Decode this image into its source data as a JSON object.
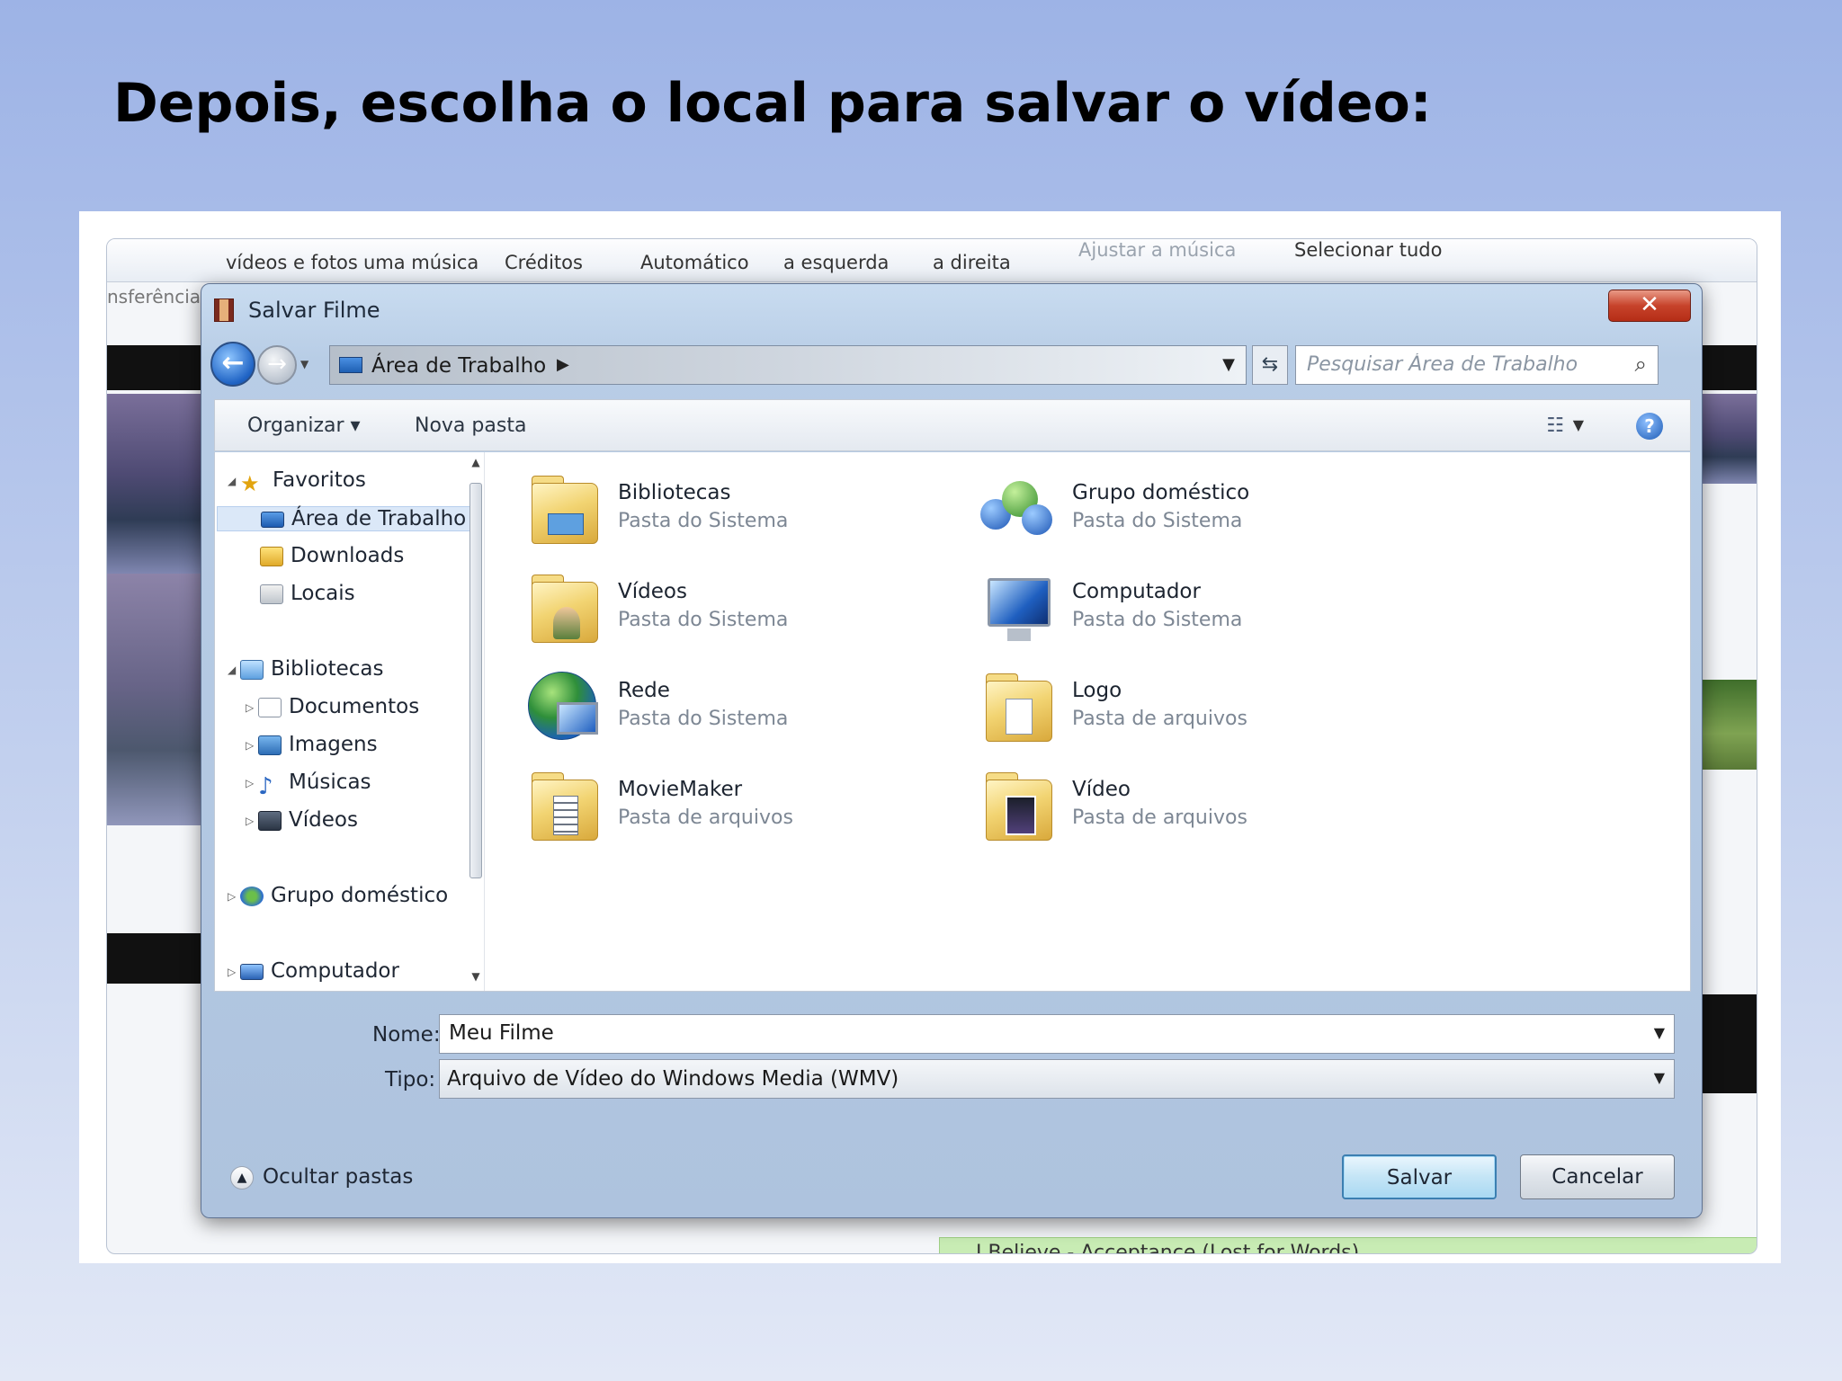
{
  "slide": {
    "title": "Depois, escolha o local para salvar o vídeo:"
  },
  "background_app": {
    "ribbon": {
      "add_videos": "vídeos e fotos",
      "add_music": "uma música",
      "credits": "Créditos",
      "auto_movie": "Automático",
      "rotate_left": "a esquerda",
      "rotate_right": "a direita",
      "fit_music": "Ajustar a música",
      "select_all": "Selecionar tudo"
    },
    "left_label": "nsferência",
    "song_caption": "I Believe - Acceptance (Lost for Words)"
  },
  "dialog": {
    "title": "Salvar Filme",
    "close_label": "✕",
    "address": {
      "path": "Área de Trabalho"
    },
    "search": {
      "placeholder": "Pesquisar Área de Trabalho"
    },
    "toolbar": {
      "organize": "Organizar ▾",
      "new_folder": "Nova pasta",
      "help": "?"
    },
    "nav_pane": {
      "favorites": "Favoritos",
      "desktop": "Área de Trabalho",
      "downloads": "Downloads",
      "places": "Locais",
      "libraries": "Bibliotecas",
      "documents": "Documentos",
      "images": "Imagens",
      "music": "Músicas",
      "videos": "Vídeos",
      "homegroup": "Grupo doméstico",
      "computer": "Computador"
    },
    "items": [
      {
        "name": "Bibliotecas",
        "type": "Pasta do Sistema",
        "icon": "libraries-icon"
      },
      {
        "name": "Grupo doméstico",
        "type": "Pasta do Sistema",
        "icon": "homegroup-icon"
      },
      {
        "name": "Vídeos",
        "type": "Pasta do Sistema",
        "icon": "videos-folder-icon"
      },
      {
        "name": "Computador",
        "type": "Pasta do Sistema",
        "icon": "computer-icon"
      },
      {
        "name": "Rede",
        "type": "Pasta do Sistema",
        "icon": "network-icon"
      },
      {
        "name": "Logo",
        "type": "Pasta de arquivos",
        "icon": "folder-icon"
      },
      {
        "name": "MovieMaker",
        "type": "Pasta de arquivos",
        "icon": "folder-icon"
      },
      {
        "name": "Vídeo",
        "type": "Pasta de arquivos",
        "icon": "folder-icon"
      }
    ],
    "form": {
      "name_label": "Nome:",
      "name_value": "Meu Filme",
      "type_label": "Tipo:",
      "type_value": "Arquivo de Vídeo do Windows Media (WMV)"
    },
    "hide_folders": "Ocultar pastas",
    "save_label": "Salvar",
    "cancel_label": "Cancelar"
  }
}
